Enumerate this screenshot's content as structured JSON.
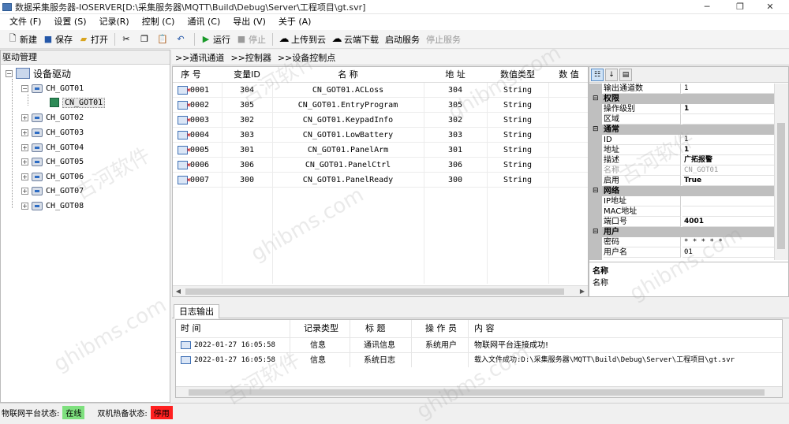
{
  "window": {
    "title": "数据采集服务器-IOSERVER[D:\\采集服务器\\MQTT\\Build\\Debug\\Server\\工程项目\\gt.svr]",
    "minimize": "─",
    "maximize": "❐",
    "close": "✕"
  },
  "menu": [
    "文件 (F)",
    "设置 (S)",
    "记录(R)",
    "控制 (C)",
    "通讯 (C)",
    "导出 (V)",
    "关于 (A)"
  ],
  "toolbar": {
    "new": "新建",
    "save": "保存",
    "open": "打开",
    "run": "运行",
    "stop": "停止",
    "upload": "上传到云",
    "download": "云端下载",
    "start_service": "启动服务",
    "stop_service": "停止服务"
  },
  "left": {
    "header": "驱动管理",
    "root": "设备驱动",
    "nodes": [
      "CH_GOT01",
      "CN_GOT01",
      "CH_GOT02",
      "CH_GOT03",
      "CH_GOT04",
      "CH_GOT05",
      "CH_GOT06",
      "CH_GOT07",
      "CH_GOT08"
    ]
  },
  "breadcrumbs": [
    ">>通讯通道",
    ">>控制器",
    ">>设备控制点"
  ],
  "grid": {
    "headers": [
      "序 号",
      "变量ID",
      "名 称",
      "地 址",
      "数值类型",
      "数 值"
    ],
    "rows": [
      {
        "seq": "0001",
        "id": "304",
        "name": "CN_GOT01.ACLoss",
        "addr": "304",
        "type": "String"
      },
      {
        "seq": "0002",
        "id": "305",
        "name": "CN_GOT01.EntryProgram",
        "addr": "305",
        "type": "String"
      },
      {
        "seq": "0003",
        "id": "302",
        "name": "CN_GOT01.KeypadInfo",
        "addr": "302",
        "type": "String"
      },
      {
        "seq": "0004",
        "id": "303",
        "name": "CN_GOT01.LowBattery",
        "addr": "303",
        "type": "String"
      },
      {
        "seq": "0005",
        "id": "301",
        "name": "CN_GOT01.PanelArm",
        "addr": "301",
        "type": "String"
      },
      {
        "seq": "0006",
        "id": "306",
        "name": "CN_GOT01.PanelCtrl",
        "addr": "306",
        "type": "String"
      },
      {
        "seq": "0007",
        "id": "300",
        "name": "CN_GOT01.PanelReady",
        "addr": "300",
        "type": "String"
      }
    ]
  },
  "props": {
    "rows": [
      {
        "kind": "prop",
        "k": "输出通道数",
        "v": "1"
      },
      {
        "kind": "cat",
        "k": "权限"
      },
      {
        "kind": "prop",
        "k": "操作级别",
        "v": "1",
        "bold": true
      },
      {
        "kind": "prop",
        "k": "区域",
        "v": ""
      },
      {
        "kind": "cat",
        "k": "通常"
      },
      {
        "kind": "prop",
        "k": "ID",
        "v": "1"
      },
      {
        "kind": "prop",
        "k": "地址",
        "v": "1",
        "bold": true
      },
      {
        "kind": "prop",
        "k": "描述",
        "v": "广拓报警",
        "bold": true
      },
      {
        "kind": "prop",
        "k": "名称",
        "v": "CN_GOT01",
        "dim": true
      },
      {
        "kind": "prop",
        "k": "启用",
        "v": "True",
        "bold": true
      },
      {
        "kind": "cat",
        "k": "网络"
      },
      {
        "kind": "prop",
        "k": "IP地址",
        "v": ""
      },
      {
        "kind": "prop",
        "k": "MAC地址",
        "v": ""
      },
      {
        "kind": "prop",
        "k": "端口号",
        "v": "4001",
        "bold": true
      },
      {
        "kind": "cat",
        "k": "用户"
      },
      {
        "kind": "prop",
        "k": "密码",
        "v": "* * * * *"
      },
      {
        "kind": "prop",
        "k": "用户名",
        "v": "01"
      }
    ],
    "desc_title": "名称",
    "desc_text": "名称"
  },
  "log": {
    "tab": "日志输出",
    "headers": [
      "时 间",
      "记录类型",
      "标 题",
      "操 作 员",
      "内 容"
    ],
    "rows": [
      {
        "time": "2022-01-27 16:05:58",
        "type": "信息",
        "title": "通讯信息",
        "op": "系统用户",
        "content": "物联网平台连接成功!"
      },
      {
        "time": "2022-01-27 16:05:58",
        "type": "信息",
        "title": "系统日志",
        "op": "",
        "content": "载入文件成功:D:\\采集服务器\\MQTT\\Build\\Debug\\Server\\工程项目\\gt.svr"
      }
    ]
  },
  "status": {
    "platform_label": "物联网平台状态:",
    "platform_value": "在线",
    "platform_color": "#7ee07e",
    "hotstandby_label": "双机热备状态:",
    "hotstandby_value": "停用",
    "hotstandby_color": "#ff2020"
  },
  "watermarks": [
    "ghibms.com",
    "古河软件"
  ]
}
